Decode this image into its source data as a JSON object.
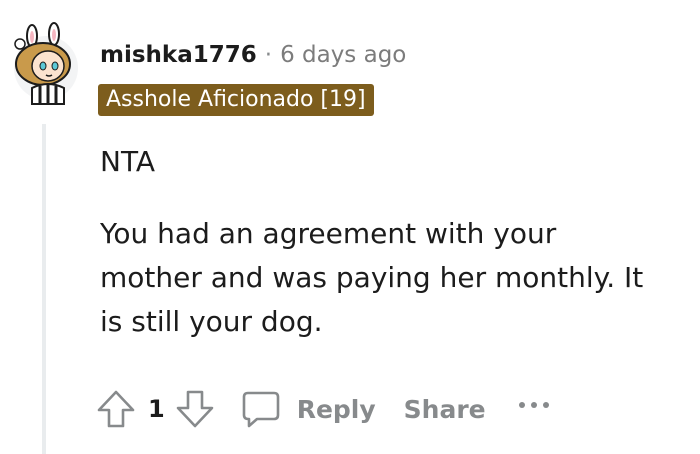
{
  "comment": {
    "author": "mishka1776",
    "separator": "·",
    "timestamp": "6 days ago",
    "flair": "Asshole Aficionado [19]",
    "flair_color": "#7d5d1d",
    "body": [
      "NTA",
      "You had an agreement with your mother and was paying her monthly. It is still your dog."
    ]
  },
  "actions": {
    "upvote_icon": "arrow-up-icon",
    "score": "1",
    "downvote_icon": "arrow-down-icon",
    "reply_icon": "speech-bubble-icon",
    "reply_label": "Reply",
    "share_label": "Share",
    "more_icon": "ellipsis-icon"
  }
}
